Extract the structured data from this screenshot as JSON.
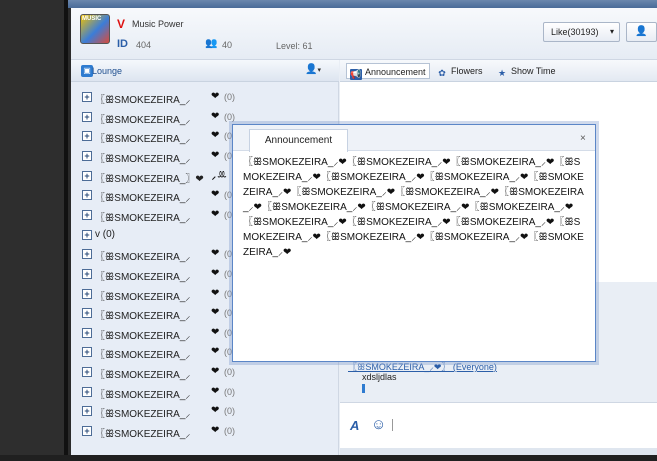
{
  "header": {
    "room_v": "V",
    "room_name": "Music Power",
    "id_label": "ID",
    "id_value": "404",
    "users_count": "40",
    "level": "Level: 61",
    "like_button": "Like(30193)",
    "like_caret": "▾",
    "logo_text": "MUSIC"
  },
  "sidebar": {
    "title": "Lounge",
    "users": [
      {
        "expander": "+",
        "name": "〖ꕥSMOKEZEIRA_⸝",
        "heart": "❤",
        "likes": "(0)"
      },
      {
        "expander": "+",
        "name": "〖ꕥSMOKEZEIRA_⸝",
        "heart": "❤",
        "likes": "(0)"
      },
      {
        "expander": "+",
        "name": "〖ꕥSMOKEZEIRA_⸝",
        "heart": "❤",
        "likes": "(0)"
      },
      {
        "expander": "+",
        "name": "〖ꕥSMOKEZEIRA_⸝",
        "heart": "❤",
        "likes": "(0)"
      },
      {
        "expander": "+",
        "name": "〖ꕥSMOKEZEIRA_〗❤",
        "heart": "⸝ꔛ",
        "likes": ""
      },
      {
        "expander": "+",
        "name": "〖ꕥSMOKEZEIRA_⸝",
        "heart": "❤",
        "likes": "(0)"
      },
      {
        "expander": "+",
        "name": "〖ꕥSMOKEZEIRA_⸝",
        "heart": "❤",
        "likes": "(0)"
      },
      {
        "expander": "+",
        "name": "v (0)",
        "heart": "",
        "likes": ""
      },
      {
        "expander": "+",
        "name": "〖ꕥSMOKEZEIRA_⸝",
        "heart": "❤",
        "likes": "(0)"
      },
      {
        "expander": "+",
        "name": "〖ꕥSMOKEZEIRA_⸝",
        "heart": "❤",
        "likes": "(0)"
      },
      {
        "expander": "+",
        "name": "〖ꕥSMOKEZEIRA_⸝",
        "heart": "❤",
        "likes": "(0)"
      },
      {
        "expander": "+",
        "name": "〖ꕥSMOKEZEIRA_⸝",
        "heart": "❤",
        "likes": "(0)"
      },
      {
        "expander": "+",
        "name": "〖ꕥSMOKEZEIRA_⸝",
        "heart": "❤",
        "likes": "(0)"
      },
      {
        "expander": "+",
        "name": "〖ꕥSMOKEZEIRA_⸝",
        "heart": "❤",
        "likes": "(0)"
      },
      {
        "expander": "+",
        "name": "〖ꕥSMOKEZEIRA_⸝",
        "heart": "❤",
        "likes": "(0)"
      },
      {
        "expander": "+",
        "name": "〖ꕥSMOKEZEIRA_⸝",
        "heart": "❤",
        "likes": "(0)"
      },
      {
        "expander": "+",
        "name": "〖ꕥSMOKEZEIRA_⸝",
        "heart": "❤",
        "likes": "(0)"
      },
      {
        "expander": "+",
        "name": "〖ꕥSMOKEZEIRA_⸝",
        "heart": "❤",
        "likes": "(0)"
      }
    ]
  },
  "toolbar": {
    "announcement": "Announcement",
    "flowers": "Flowers",
    "show_time": "Show Time"
  },
  "chat": {
    "link_text": "〖ꕥSMOKEZEIRA_⸝❤〗 (Everyone)",
    "message": "xdsljdlas"
  },
  "dialog": {
    "tab_label": "Announcement",
    "close": "×",
    "body": "〖ꕥSMOKEZEIRA_⸝❤〖ꕥSMOKEZEIRA_⸝❤〖ꕥSMOKEZEIRA_⸝❤〖ꕥSMOKEZEIRA_⸝❤〖ꕥSMOKEZEIRA_⸝❤〖ꕥSMOKEZEIRA_⸝❤〖ꕥSMOKEZEIRA_⸝❤〖ꕥSMOKEZEIRA_⸝❤〖ꕥSMOKEZEIRA_⸝❤〖ꕥSMOKEZEIRA_⸝❤〖ꕥSMOKEZEIRA_⸝❤〖ꕥSMOKEZEIRA_⸝❤〖ꕥSMOKEZEIRA_⸝❤〖ꕥSMOKEZEIRA_⸝❤〖ꕥSMOKEZEIRA_⸝❤〖ꕥSMOKEZEIRA_⸝❤〖ꕥSMOKEZEIRA_⸝❤〖ꕥSMOKEZEIRA_⸝❤〖ꕥSMOKEZEIRA_⸝❤〖ꕥSMOKEZEIRA_⸝❤"
  },
  "colors": {
    "accent": "#2b5ea8",
    "dialog_border": "#5b86c7",
    "brand_red": "#dd1111"
  },
  "icons": {
    "announcement": "megaphone-icon",
    "flowers": "flower-icon",
    "show_time": "star-icon",
    "users": "users-icon",
    "lounge": "lounge-icon",
    "font": "font-icon",
    "emoji": "smile-icon"
  }
}
